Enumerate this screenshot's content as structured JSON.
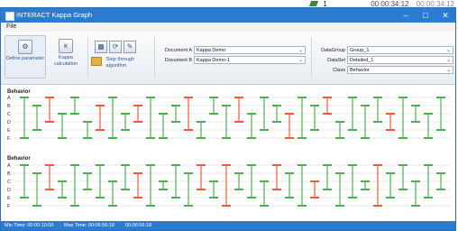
{
  "background": {
    "row_fragment": "1",
    "timestamp_a": "00:00:34:12",
    "timestamp_b": "00:00:34:12"
  },
  "window": {
    "title": "INTERACT Kappa Graph",
    "title_color": "#2b7bd0"
  },
  "menu": {
    "file": "File"
  },
  "ribbon": {
    "define_parameter": "Define parameter",
    "kappa_calculation": "Kappa calculation",
    "step_through": "Step through algorithm"
  },
  "fields": {
    "document_a_label": "Document A",
    "document_a_value": "Kappa Demo",
    "document_b_label": "Document B",
    "document_b_value": "Kappa Demo-1",
    "datagroup_label": "DataGroup",
    "datagroup_value": "Group_1",
    "dataset_label": "DataSet",
    "dataset_value": "Detailed_1",
    "class_label": "Class",
    "class_value": "Behavior"
  },
  "graph": {
    "top_label": "Behavior",
    "bottom_label": "Behavior",
    "codes": [
      "A",
      "B",
      "C",
      "D",
      "E",
      "F"
    ],
    "match_color": "#4caf50",
    "mismatch_color": "#f05a3c"
  },
  "status": {
    "min_time": "Min Time: 00:00:10:00",
    "max_time": "Max Time: 00:06:56:18",
    "duration": "00:06:56:18"
  }
}
